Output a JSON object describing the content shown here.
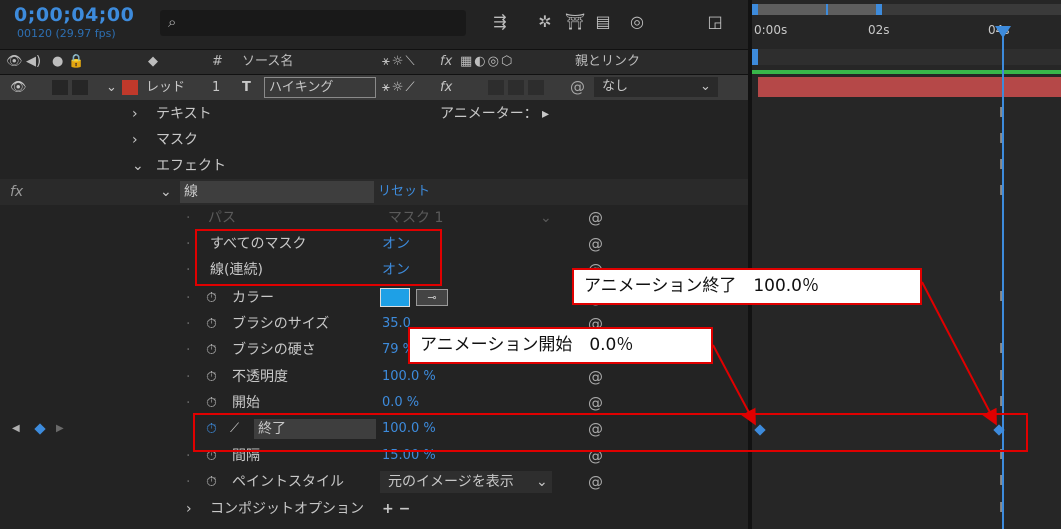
{
  "timecode": "0;00;04;00",
  "frames": "00120 (29.97 fps)",
  "columns": {
    "switches_hash": "#",
    "source_name": "ソース名",
    "switches_fx": "fx",
    "parent_link": "親とリンク"
  },
  "layer": {
    "label": "レッド",
    "number": "1",
    "type_icon": "T",
    "name": "ハイキング",
    "parent": "なし"
  },
  "properties": {
    "text": "テキスト",
    "animator_label": "アニメーター：",
    "mask": "マスク",
    "effects": "エフェクト",
    "fx_label": "fx",
    "effect_name": "線",
    "reset": "リセット",
    "path_label": "パス",
    "path_value": "マスク 1",
    "all_masks_label": "すべてのマスク",
    "all_masks_value": "オン",
    "stroke_seq_label": "線(連続)",
    "stroke_seq_value": "オン",
    "color_label": "カラー",
    "brush_size_label": "ブラシのサイズ",
    "brush_size_value": "35.0",
    "brush_hardness_label": "ブラシの硬さ",
    "brush_hardness_value": "79 %",
    "opacity_label": "不透明度",
    "opacity_value": "100.0 %",
    "start_label": "開始",
    "start_value": "0.0 %",
    "end_label": "終了",
    "end_value": "100.0 %",
    "spacing_label": "間隔",
    "spacing_value": "15.00 %",
    "paint_style_label": "ペイントスタイル",
    "paint_style_value": "元のイメージを表示",
    "composite_label": "コンポジットオプション",
    "composite_value": "+ −"
  },
  "timeline": {
    "ticks": [
      "0:00s",
      "02s",
      "04s"
    ],
    "playhead_seconds": 4
  },
  "callouts": {
    "end": "アニメーション終了　100.0％",
    "start": "アニメーション開始　0.0％"
  },
  "colors": {
    "accent": "#3d8bdc",
    "highlight_red": "#e00000",
    "layer_label": "#c0392b",
    "stroke_color_swatch": "#1ea0e6"
  }
}
